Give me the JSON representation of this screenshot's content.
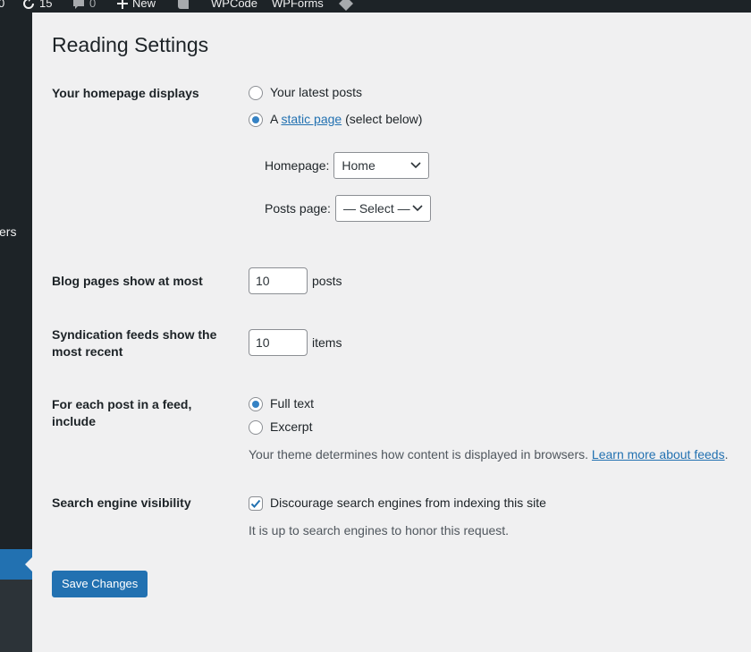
{
  "admin_bar": {
    "site_count": "0",
    "updates_count": "15",
    "comments_count": "0",
    "new_label": "New",
    "wpcode_label": "WPCode",
    "wpforms_label": "WPForms"
  },
  "sidebar": {
    "partial_menu_text": "ers"
  },
  "page": {
    "title": "Reading Settings"
  },
  "homepage_displays": {
    "label": "Your homepage displays",
    "option_latest": "Your latest posts",
    "option_static_prefix": "A",
    "option_static_link": "static page",
    "option_static_suffix": "(select below)",
    "homepage_label": "Homepage:",
    "homepage_value": "Home",
    "posts_page_label": "Posts page:",
    "posts_page_value": "— Select —"
  },
  "blog_pages": {
    "label": "Blog pages show at most",
    "value": "10",
    "unit": "posts"
  },
  "syndication": {
    "label": "Syndication feeds show the most recent",
    "value": "10",
    "unit": "items"
  },
  "feed_content": {
    "label": "For each post in a feed, include",
    "option_full": "Full text",
    "option_excerpt": "Excerpt",
    "description": "Your theme determines how content is displayed in browsers.",
    "learn_more": "Learn more about feeds",
    "period": "."
  },
  "search_visibility": {
    "label": "Search engine visibility",
    "checkbox_label": "Discourage search engines from indexing this site",
    "description": "It is up to search engines to honor this request."
  },
  "buttons": {
    "save": "Save Changes"
  },
  "colors": {
    "accent": "#2271b1",
    "admin_bar": "#1d2327",
    "background": "#f0f0f1"
  }
}
